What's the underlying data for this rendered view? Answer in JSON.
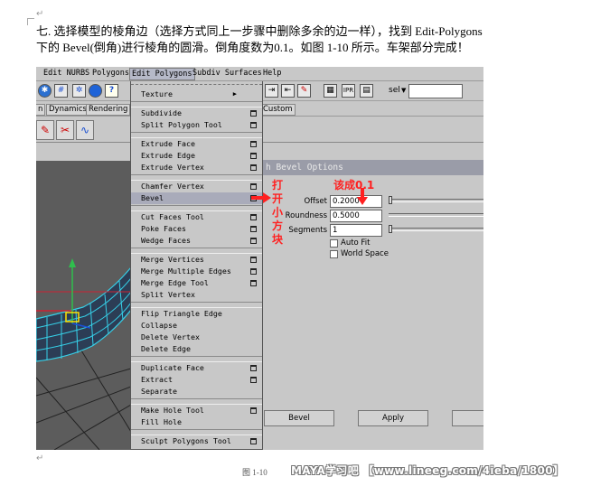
{
  "document": {
    "line1": "七.    选择模型的棱角边（选择方式同上一步骤中删除多余的边一样），找到 Edit-Polygons",
    "line2": "下的 Bevel(倒角)进行棱角的圆滑。倒角度数为0.1。如图 1-10 所示。车架部分完成！",
    "return_mark": "↵",
    "caption": "图 1-10",
    "watermark": "MAYA学习吧 【www.lineeg.com/4ieba/1800】"
  },
  "menubar": {
    "items": [
      "Edit NURBS",
      "Polygons",
      "Edit Polygons",
      "Subdiv Surfaces",
      "Help"
    ],
    "active": "Edit Polygons"
  },
  "toolbar": {
    "sel_label": "sel",
    "sel_value": ""
  },
  "shelf": {
    "tabs": [
      "n",
      "Dynamics",
      "Rendering",
      "Custom"
    ]
  },
  "edit_polygons_menu": {
    "groups": [
      [
        {
          "label": "Texture",
          "submenu": true
        }
      ],
      [
        {
          "label": "Subdivide",
          "option": true
        },
        {
          "label": "Split Polygon Tool",
          "option": true
        }
      ],
      [
        {
          "label": "Extrude Face",
          "option": true
        },
        {
          "label": "Extrude Edge",
          "option": true
        },
        {
          "label": "Extrude Vertex",
          "option": true
        }
      ],
      [
        {
          "label": "Chamfer Vertex",
          "option": true
        },
        {
          "label": "Bevel",
          "option": true,
          "highlighted": true
        }
      ],
      [
        {
          "label": "Cut Faces Tool",
          "option": true
        },
        {
          "label": "Poke Faces",
          "option": true
        },
        {
          "label": "Wedge Faces",
          "option": true
        }
      ],
      [
        {
          "label": "Merge Vertices",
          "option": true
        },
        {
          "label": "Merge Multiple Edges",
          "option": true
        },
        {
          "label": "Merge Edge Tool",
          "option": true
        },
        {
          "label": "Split Vertex",
          "option": false
        }
      ],
      [
        {
          "label": "Flip Triangle Edge",
          "option": false
        },
        {
          "label": "Collapse",
          "option": false
        },
        {
          "label": "Delete Vertex",
          "option": false
        },
        {
          "label": "Delete Edge",
          "option": false
        }
      ],
      [
        {
          "label": "Duplicate Face",
          "option": true
        },
        {
          "label": "Extract",
          "option": true
        },
        {
          "label": "Separate",
          "option": false
        }
      ],
      [
        {
          "label": "Make Hole Tool",
          "option": true
        },
        {
          "label": "Fill Hole",
          "option": false
        }
      ],
      [
        {
          "label": "Sculpt Polygons Tool",
          "option": true
        }
      ]
    ]
  },
  "bevel_options": {
    "title": "h Bevel Options",
    "offset_label": "Offset",
    "offset_value": "0.2000",
    "roundness_label": "Roundness",
    "roundness_value": "0.5000",
    "segments_label": "Segments",
    "segments_value": "1",
    "auto_fit_label": "Auto Fit",
    "world_space_label": "World Space",
    "bevel_button": "Bevel",
    "apply_button": "Apply"
  },
  "annotations": {
    "change_to": "该成0.1",
    "open_box_chars": [
      "打",
      "开",
      "小",
      "方",
      "块"
    ],
    "color": "#ff2020"
  }
}
